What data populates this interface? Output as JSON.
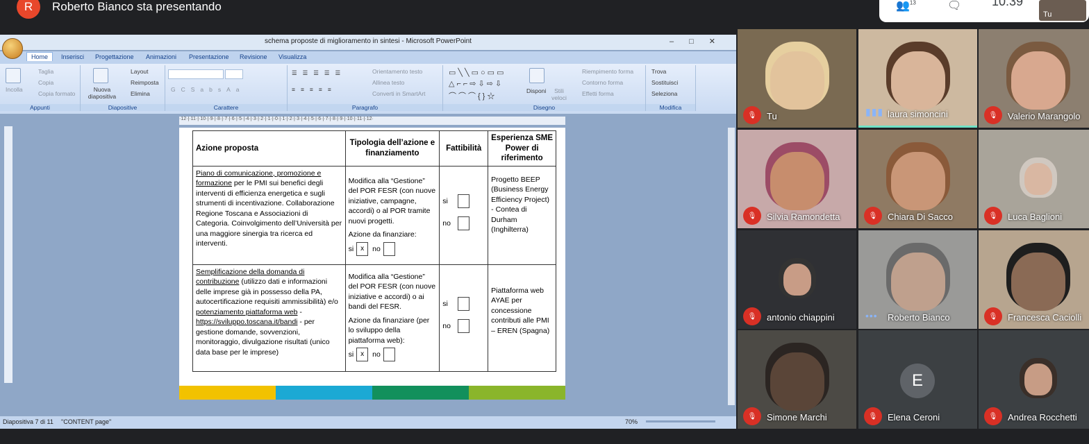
{
  "meet": {
    "presenter_initial": "R",
    "presenting_text": "Roberto Bianco sta presentando",
    "participants_count": "13",
    "clock": "10:39",
    "self_label": "Tu"
  },
  "ppt": {
    "window_title": "schema proposte di miglioramento in sintesi - Microsoft PowerPoint",
    "tabs": [
      "Home",
      "Inserisci",
      "Progettazione",
      "Animazioni",
      "Presentazione",
      "Revisione",
      "Visualizza"
    ],
    "groups": {
      "appunti": "Appunti",
      "diapositive": "Diapositive",
      "carattere": "Carattere",
      "paragrafo": "Paragrafo",
      "disegno": "Disegno",
      "modifica": "Modifica"
    },
    "buttons": {
      "taglia": "Taglia",
      "copia": "Copia",
      "copia_formato": "Copia formato",
      "incolla": "Incolla",
      "nuova": "Nuova diapositiva",
      "layout": "Layout",
      "reimposta": "Reimposta",
      "elimina": "Elimina",
      "orientamento": "Orientamento testo",
      "allinea": "Allinea testo",
      "converti": "Converti in SmartArt",
      "disponi": "Disponi",
      "stili": "Stili veloci",
      "riempimento": "Riempimento forma",
      "contorno": "Contorno forma",
      "effetti": "Effetti forma",
      "trova": "Trova",
      "sostituisci": "Sostituisci",
      "seleziona": "Seleziona"
    },
    "status": {
      "slide": "Diapositiva 7 di 11",
      "theme": "\"CONTENT page\"",
      "zoom": "70%"
    },
    "slide_number": "7",
    "table": {
      "headers": [
        "Azione proposta",
        "Tipologia dell’azione e finanziamento",
        "Fattibilità",
        "Esperienza SME Power di riferimento"
      ],
      "row1": {
        "link": "Piano di comunicazione, promozione e formazione",
        "text": " per le PMI sui benefici degli interventi di efficienza energetica e sugli strumenti di incentivazione. Collaborazione Regione Toscana e Associazioni di Categoria. Coinvolgimento dell’Università per una maggiore sinergia tra ricerca ed interventi.",
        "tipologia": "Modifica alla “Gestione” del POR FESR (con nuove iniziative, campagne, accordi) o al POR tramite nuovi progetti.",
        "finanziare": "Azione da finanziare:",
        "si": "si",
        "no": "no",
        "x": "x",
        "esperienza": "Progetto BEEP (Business Energy Efficiency Project) - Contea di Durham (Inghilterra)"
      },
      "row2": {
        "link1": "Semplificazione della domanda di contribuzione",
        "text1": " (utilizzo dati e informazioni delle imprese già in possesso della PA, autocertificazione requisiti ammissibilità) e/o ",
        "link2": "potenziamento piattaforma web",
        "text2": " - ",
        "url": "https://sviluppo.toscana.it/bandi",
        "text3": " - per gestione domande, sovvenzioni, monitoraggio, divulgazione risultati (unico data base per le imprese)",
        "tipologia": "Modifica alla “Gestione” del POR FESR (con nuove iniziative e accordi) o ai bandi del FESR.",
        "finanziare": "Azione da finanziare (per lo sviluppo della piattaforma web):",
        "si": "si",
        "no": "no",
        "x": "x",
        "esperienza": "Piattaforma web AYAE per concessione contributi alle PMI – EREN (Spagna)"
      }
    },
    "strip_colors": [
      "#f2c200",
      "#1ba9d4",
      "#12905c",
      "#8ab52b"
    ]
  },
  "participants": [
    {
      "name": "Tu"
    },
    {
      "name": "laura simoncini"
    },
    {
      "name": "Valerio Marangolo"
    },
    {
      "name": "Silvia Ramondetta"
    },
    {
      "name": "Chiara Di Sacco"
    },
    {
      "name": "Luca Baglioni"
    },
    {
      "name": "antonio chiappini"
    },
    {
      "name": "Roberto Bianco"
    },
    {
      "name": "Francesca Caciolli"
    },
    {
      "name": "Simone Marchi"
    },
    {
      "name": "Elena Ceroni",
      "initial": "E"
    },
    {
      "name": "Andrea Rocchetti"
    }
  ]
}
